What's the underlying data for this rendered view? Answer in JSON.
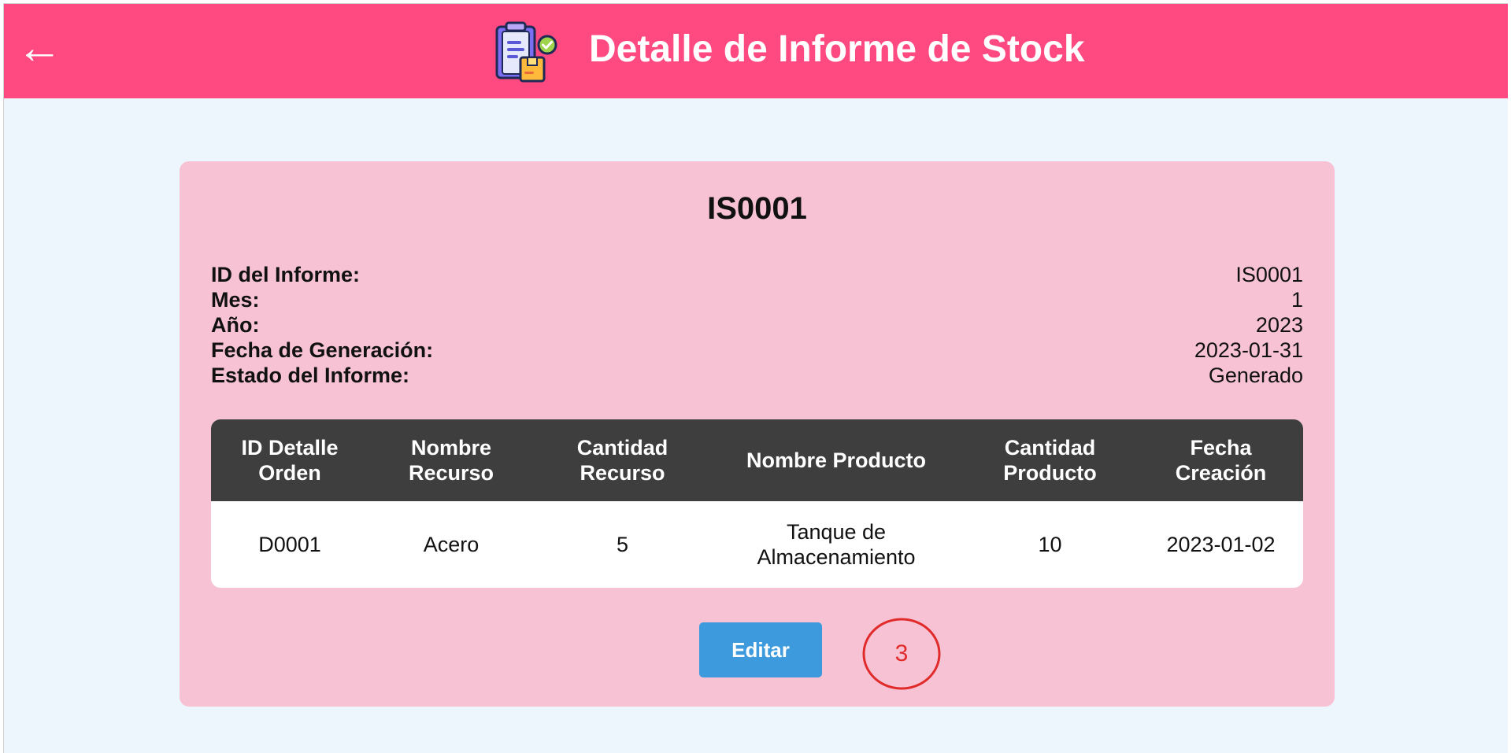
{
  "header": {
    "back_icon": "←",
    "title": "Detalle de Informe de Stock",
    "logo_icon": "clipboard-box-check-icon"
  },
  "report": {
    "heading": "IS0001",
    "fields": [
      {
        "label": "ID del Informe:",
        "value": "IS0001"
      },
      {
        "label": "Mes:",
        "value": "1"
      },
      {
        "label": "Año:",
        "value": "2023"
      },
      {
        "label": "Fecha de Generación:",
        "value": "2023-01-31"
      },
      {
        "label": "Estado del Informe:",
        "value": "Generado"
      }
    ]
  },
  "table": {
    "columns": [
      "ID Detalle Orden",
      "Nombre Recurso",
      "Cantidad Recurso",
      "Nombre Producto",
      "Cantidad Producto",
      "Fecha Creación"
    ],
    "rows": [
      [
        "D0001",
        "Acero",
        "5",
        "Tanque de Almacenamiento",
        "10",
        "2023-01-02"
      ]
    ]
  },
  "actions": {
    "edit_label": "Editar"
  },
  "annotation": {
    "number": "3"
  },
  "colors": {
    "header": "#ff4a81",
    "card": "#f7c3d4",
    "table_header": "#3e3e3e",
    "button": "#3d9add",
    "annotation": "#e12a2a",
    "page_bg": "#edf5fd"
  }
}
